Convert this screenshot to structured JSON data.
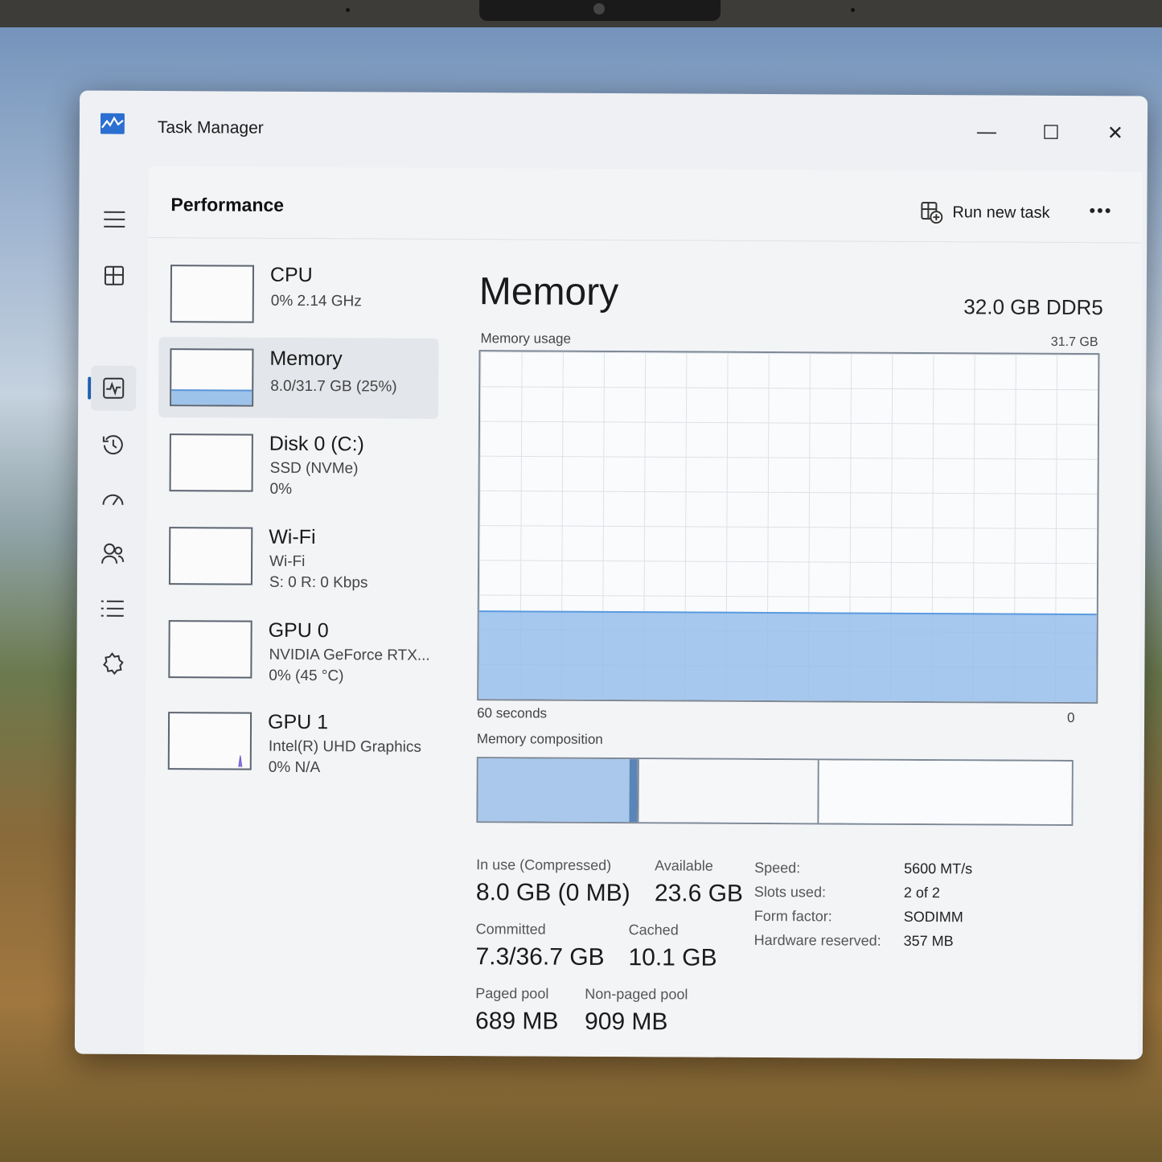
{
  "window": {
    "title": "Task Manager",
    "minimize_glyph": "—",
    "maximize_glyph": "☐",
    "close_glyph": "✕"
  },
  "nav": {
    "icons": [
      "hamburger-menu-icon",
      "processes-icon",
      "performance-icon",
      "app-history-icon",
      "startup-apps-icon",
      "users-icon",
      "details-icon",
      "services-icon",
      "settings-icon"
    ],
    "active": "performance-icon"
  },
  "header": {
    "title": "Performance",
    "run_new_task": "Run new task",
    "more": "•••"
  },
  "resources": [
    {
      "name": "CPU",
      "line1": "0%  2.14 GHz",
      "line2": ""
    },
    {
      "name": "Memory",
      "line1": "8.0/31.7 GB (25%)",
      "line2": "",
      "usage": 0.25
    },
    {
      "name": "Disk 0 (C:)",
      "line1": "SSD (NVMe)",
      "line2": "0%"
    },
    {
      "name": "Wi-Fi",
      "line1": "Wi-Fi",
      "line2": "S: 0  R: 0 Kbps"
    },
    {
      "name": "GPU 0",
      "line1": "NVIDIA GeForce RTX...",
      "line2": "0%  (45 °C)"
    },
    {
      "name": "GPU 1",
      "line1": "Intel(R) UHD Graphics",
      "line2": "0%  N/A"
    }
  ],
  "memory": {
    "title": "Memory",
    "total": "32.0 GB DDR5",
    "usage_label": "Memory usage",
    "usage_max": "31.7 GB",
    "time_left": "60 seconds",
    "time_right": "0",
    "composition_label": "Memory composition",
    "usage_fraction": 0.25,
    "stats": {
      "in_use_label": "In use (Compressed)",
      "in_use_value": "8.0 GB (0 MB)",
      "available_label": "Available",
      "available_value": "23.6 GB",
      "committed_label": "Committed",
      "committed_value": "7.3/36.7 GB",
      "cached_label": "Cached",
      "cached_value": "10.1 GB",
      "paged_label": "Paged pool",
      "paged_value": "689 MB",
      "nonpaged_label": "Non-paged pool",
      "nonpaged_value": "909 MB"
    },
    "specs": [
      {
        "key": "Speed:",
        "value": "5600 MT/s"
      },
      {
        "key": "Slots used:",
        "value": "2 of 2"
      },
      {
        "key": "Form factor:",
        "value": "SODIMM"
      },
      {
        "key": "Hardware reserved:",
        "value": "357 MB"
      }
    ]
  },
  "colors": {
    "accent": "#1f5fb0",
    "memory_fill": "#9ec3ea",
    "memory_line": "#5b9be0"
  }
}
